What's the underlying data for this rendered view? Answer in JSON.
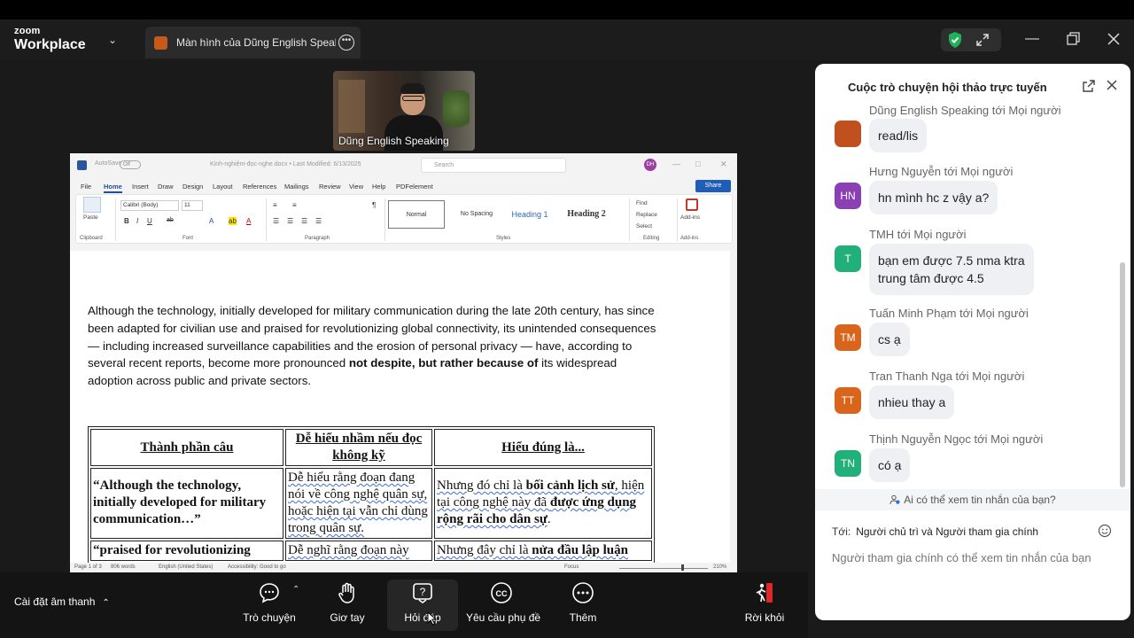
{
  "app": {
    "logo_line1": "zoom",
    "logo_line2": "Workplace"
  },
  "share_tab": {
    "label": "Màn hình của Dũng English Speal"
  },
  "video": {
    "participant_name": "Dũng English Speaking"
  },
  "word": {
    "autosave_label": "AutoSave",
    "autosave_state": "Off",
    "doc_title": "Kinh-nghiệm-đọc-nghe.docx • Last Modified: 6/13/2025",
    "search_placeholder": "Search",
    "avatar": "DH",
    "menu": [
      "File",
      "Home",
      "Insert",
      "Draw",
      "Design",
      "Layout",
      "References",
      "Mailings",
      "Review",
      "View",
      "Help",
      "PDFelement"
    ],
    "share_label": "Share",
    "ribbon": {
      "paste": "Paste",
      "clipboard": "Clipboard",
      "font_name": "Calibri (Body)",
      "font_size": "11",
      "font_group": "Font",
      "paragraph_group": "Paragraph",
      "styles": [
        "Normal",
        "No Spacing",
        "Heading 1",
        "Heading 2"
      ],
      "styles_group": "Styles",
      "find": "Find",
      "replace": "Replace",
      "select": "Select",
      "editing_group": "Editing",
      "addins": "Add-ins",
      "addins_group": "Add-ins"
    },
    "paragraph": {
      "text_before_bold": "Although the technology, initially developed for military communication during the late 20th century, has since been adapted for civilian use and praised for revolutionizing global connectivity, its unintended consequences — including increased surveillance capabilities and the erosion of personal privacy — have, according to several recent reports, become more pronounced ",
      "bold_text": "not despite, but rather because of",
      "text_after_bold": " its widespread adoption across public and private sectors."
    },
    "table": {
      "headers": [
        "Thành phần câu",
        "Dễ hiểu nhầm nếu đọc không kỹ",
        "Hiểu đúng là..."
      ],
      "row1": {
        "c1": "“Although the technology, initially developed for military communication…”",
        "c2": "Dễ hiểu rằng đoạn đang nói về công nghệ quân sự, hoặc hiện tại vẫn chỉ dùng trong quân sự.",
        "c3_pre": "Nhưng đó chỉ là ",
        "c3_b1": "bối cảnh lịch sử",
        "c3_mid": ", hiện tại công nghệ này đã ",
        "c3_b2": "được ứng dụng rộng rãi cho dân sự",
        "c3_post": "."
      },
      "row2": {
        "c1": "“praised for revolutionizing",
        "c2": "Dễ nghĩ rằng đoạn này",
        "c3_pre": "Nhưng đây chỉ là ",
        "c3_b1": "nửa đầu lập luận"
      }
    },
    "status": {
      "page": "Page 1 of 3",
      "words": "806 words",
      "language": "English (United States)",
      "accessibility": "Accessibility: Good to go",
      "focus": "Focus",
      "zoom": "210%"
    }
  },
  "toolbar": {
    "audio_label": "Cài đặt âm thanh",
    "chat": "Trò chuyện",
    "raise_hand": "Giơ tay",
    "qa": "Hỏi đáp",
    "captions": "Yêu cầu phụ đề",
    "more": "Thêm",
    "leave": "Rời khỏi",
    "leave_color": "#e02828"
  },
  "chat": {
    "title": "Cuộc trò chuyện hội thảo trực tuyến",
    "messages": [
      {
        "sender": "Dũng English Speaking tới Mọi người",
        "text": "read/lis",
        "avatar": "",
        "color": "#c0511f"
      },
      {
        "sender": "Hưng Nguyễn tới Mọi người",
        "text": "hn mình hc z vậy a?",
        "avatar": "HN",
        "color": "#8a3fb3"
      },
      {
        "sender": "TMH tới Mọi người",
        "text_line1": "bạn em được 7.5 nma ktra",
        "text_line2": "trung tâm được 4.5",
        "avatar": "T",
        "color": "#22b07a"
      },
      {
        "sender": "Tuấn Minh Phạm tới Mọi người",
        "text": "cs ạ",
        "avatar": "TM",
        "color": "#d9641c"
      },
      {
        "sender": "Tran Thanh Nga tới Mọi người",
        "text": "nhieu thay a",
        "avatar": "TT",
        "color": "#d9641c"
      },
      {
        "sender": "Thịnh Nguyễn Ngọc tới Mọi người",
        "text": "có ạ",
        "avatar": "TN",
        "color": "#22b07a"
      }
    ],
    "privacy": "Ai có thể xem tin nhắn của bạn?",
    "to_label": "Tới:",
    "to_value": "Người chủ trì và Người tham gia chính",
    "input_placeholder": "Người tham gia chính có thể xem tin nhắn của bạn"
  }
}
